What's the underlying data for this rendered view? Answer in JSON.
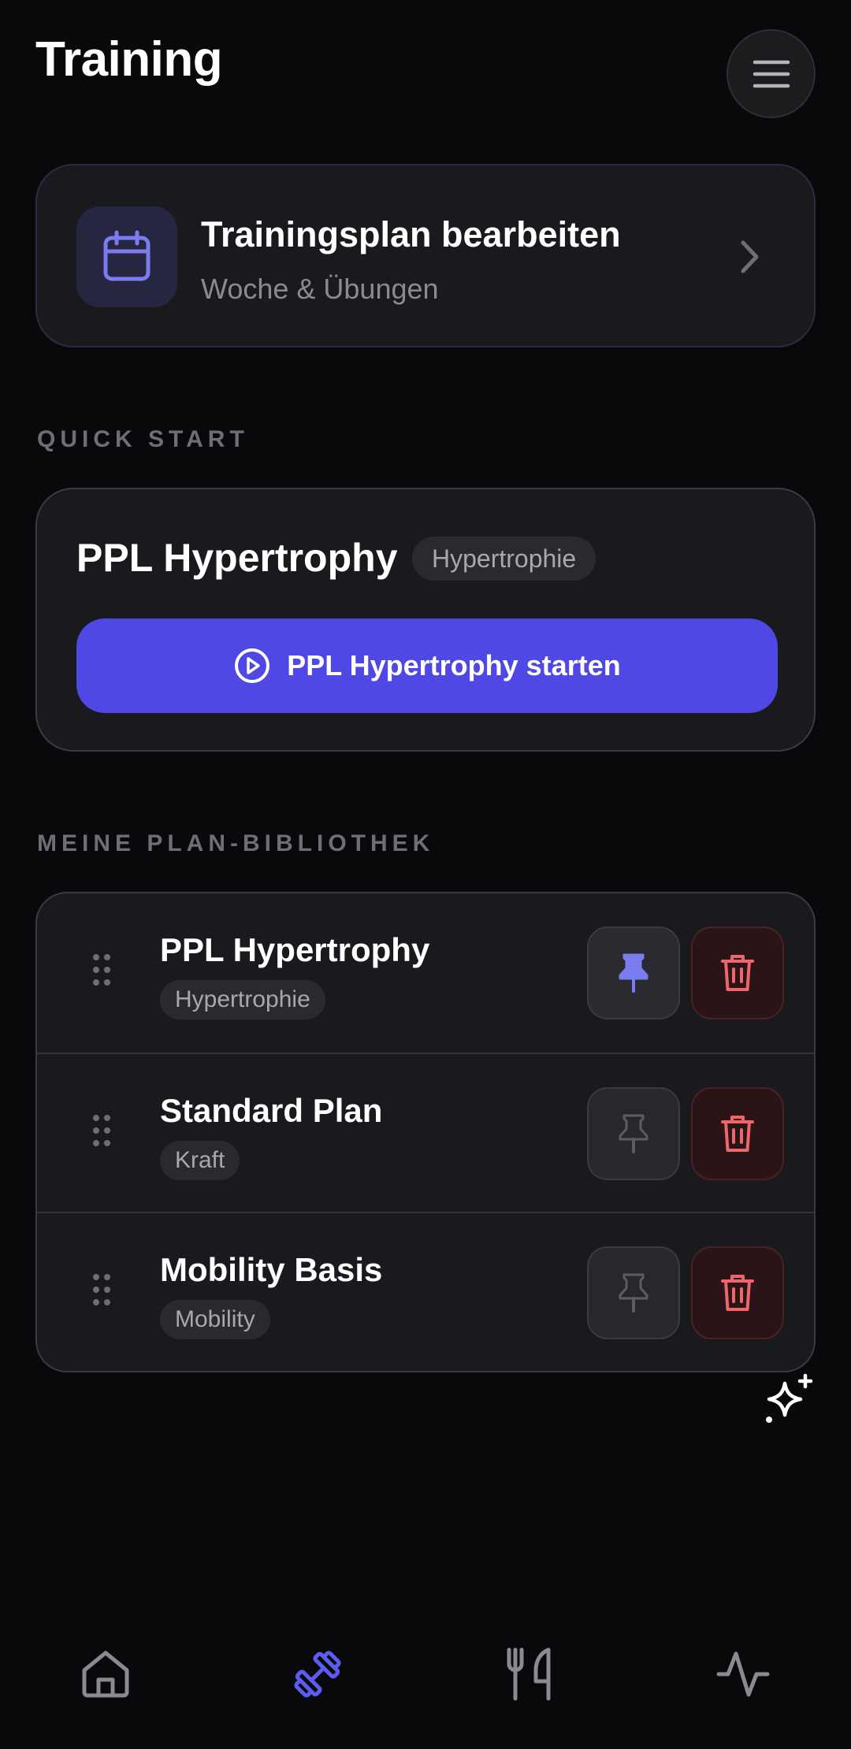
{
  "header": {
    "title": "Training",
    "menu_icon": "hamburger-menu-icon"
  },
  "edit_plan": {
    "title": "Trainingsplan bearbeiten",
    "subtitle": "Woche & Übungen",
    "icon": "calendar-icon"
  },
  "quick_start": {
    "section_label": "QUICK START",
    "plan_name": "PPL Hypertrophy",
    "badge": "Hypertrophie",
    "start_label": "PPL Hypertrophy starten"
  },
  "library": {
    "section_label": "MEINE PLAN-BIBLIOTHEK",
    "plans": [
      {
        "name": "PPL Hypertrophy",
        "tag": "Hypertrophie",
        "pinned": true
      },
      {
        "name": "Standard Plan",
        "tag": "Kraft",
        "pinned": false
      },
      {
        "name": "Mobility Basis",
        "tag": "Mobility",
        "pinned": false
      }
    ]
  },
  "bottom_nav": {
    "items": [
      {
        "icon": "home-icon",
        "active": false
      },
      {
        "icon": "dumbbell-icon",
        "active": true
      },
      {
        "icon": "fork-knife-icon",
        "active": false
      },
      {
        "icon": "activity-icon",
        "active": false
      }
    ]
  },
  "colors": {
    "accent": "#5048e5",
    "accent_icon": "#7b7cf0",
    "danger": "#f0646c",
    "background": "#09090b",
    "card": "#1a1a1e"
  }
}
